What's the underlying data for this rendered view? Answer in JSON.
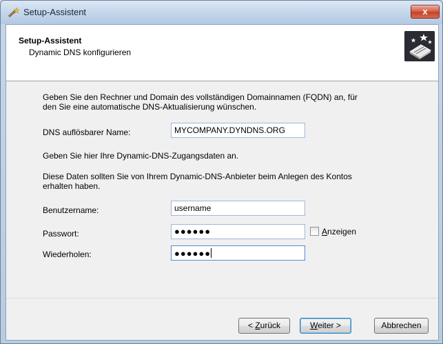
{
  "window": {
    "title": "Setup-Assistent",
    "close_label": "x"
  },
  "header": {
    "title": "Setup-Assistent",
    "subtitle": "Dynamic DNS konfigurieren"
  },
  "body": {
    "intro_line1": "Geben Sie den Rechner und Domain des vollständigen Domainnamen (FQDN) an, für",
    "intro_line2": "den Sie eine automatische DNS-Aktualisierung wünschen.",
    "dns_label": "DNS auflösbarer Name:",
    "dns_value": "MYCOMPANY.DYNDNS.ORG",
    "access_text": "Geben Sie hier Ihre Dynamic-DNS-Zugangsdaten an.",
    "provider_line1": "Diese Daten sollten Sie von Ihrem Dynamic-DNS-Anbieter beim Anlegen des Kontos",
    "provider_line2": "erhalten haben.",
    "username_label": "Benutzername:",
    "username_value": "username",
    "password_label": "Passwort:",
    "password_value": "●●●●●●",
    "repeat_label": "Wiederholen:",
    "repeat_value": "●●●●●●",
    "show_label_mnemonic": "A",
    "show_label_rest": "nzeigen"
  },
  "buttons": {
    "back_prefix": "< ",
    "back_mnemonic": "Z",
    "back_rest": "urück",
    "next_mnemonic": "W",
    "next_rest": "eiter >",
    "cancel": "Abbrechen"
  }
}
